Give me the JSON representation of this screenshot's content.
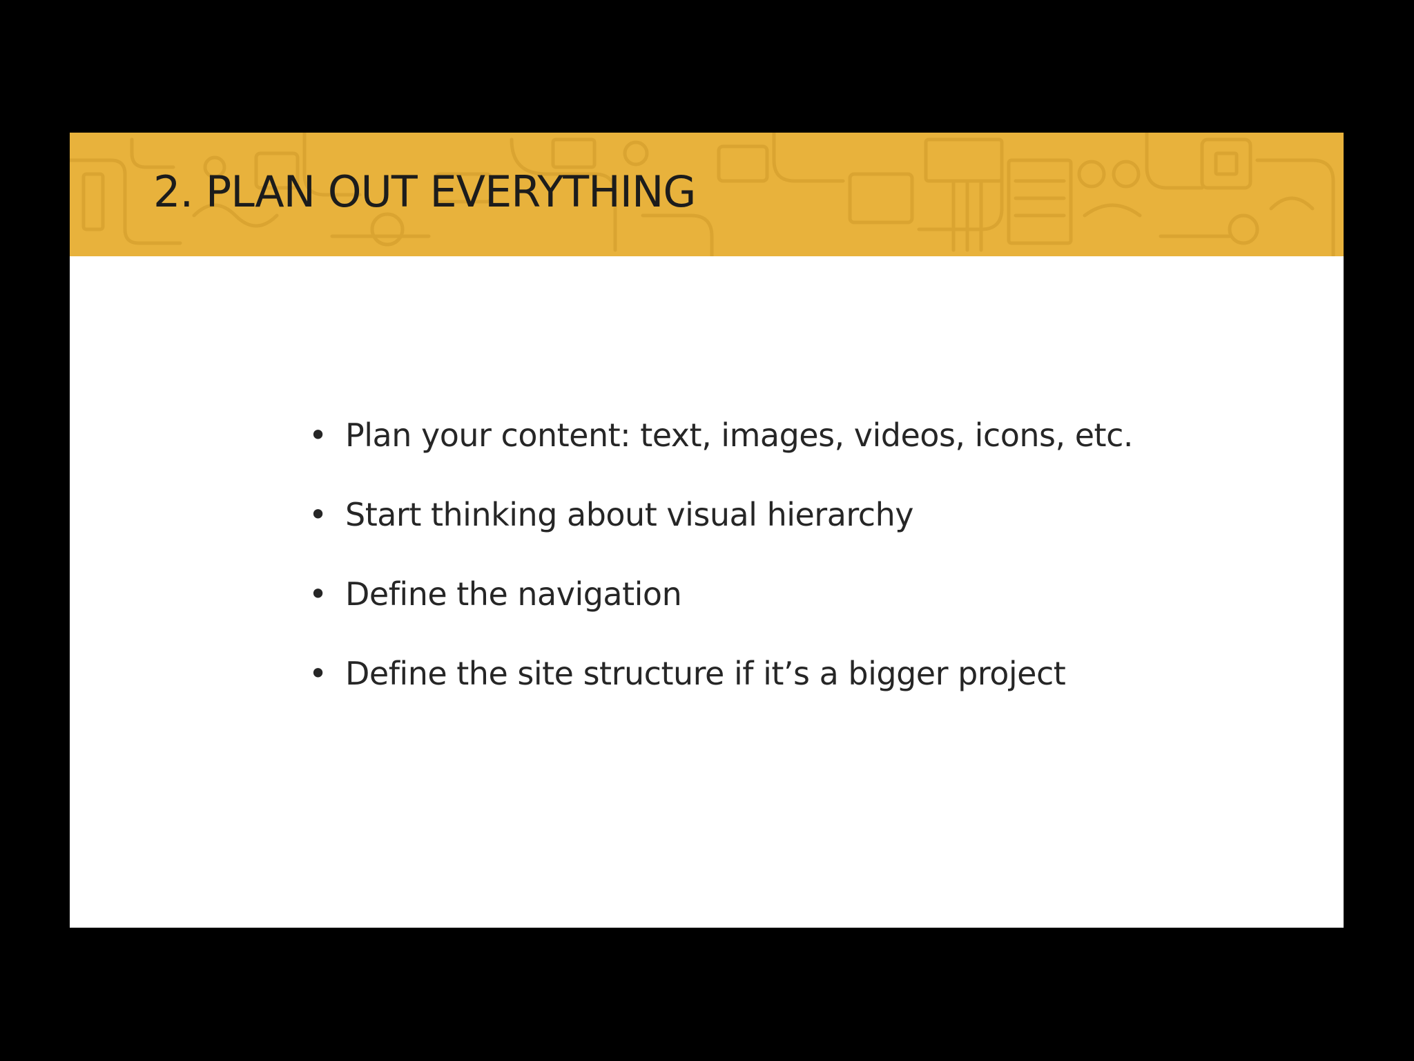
{
  "slide": {
    "title": "2. PLAN OUT EVERYTHING",
    "bullet_glyph": "•",
    "bullets": [
      "Plan your content: text, images, videos, icons, etc.",
      "Start thinking about visual hierarchy",
      "Define the navigation",
      "Define the site structure if it’s a bigger project"
    ]
  },
  "colors": {
    "background": "#000000",
    "slide": "#ffffff",
    "banner": "#e8b23c",
    "banner_pattern": "#d9a22f",
    "text": "#1c1c1c"
  }
}
